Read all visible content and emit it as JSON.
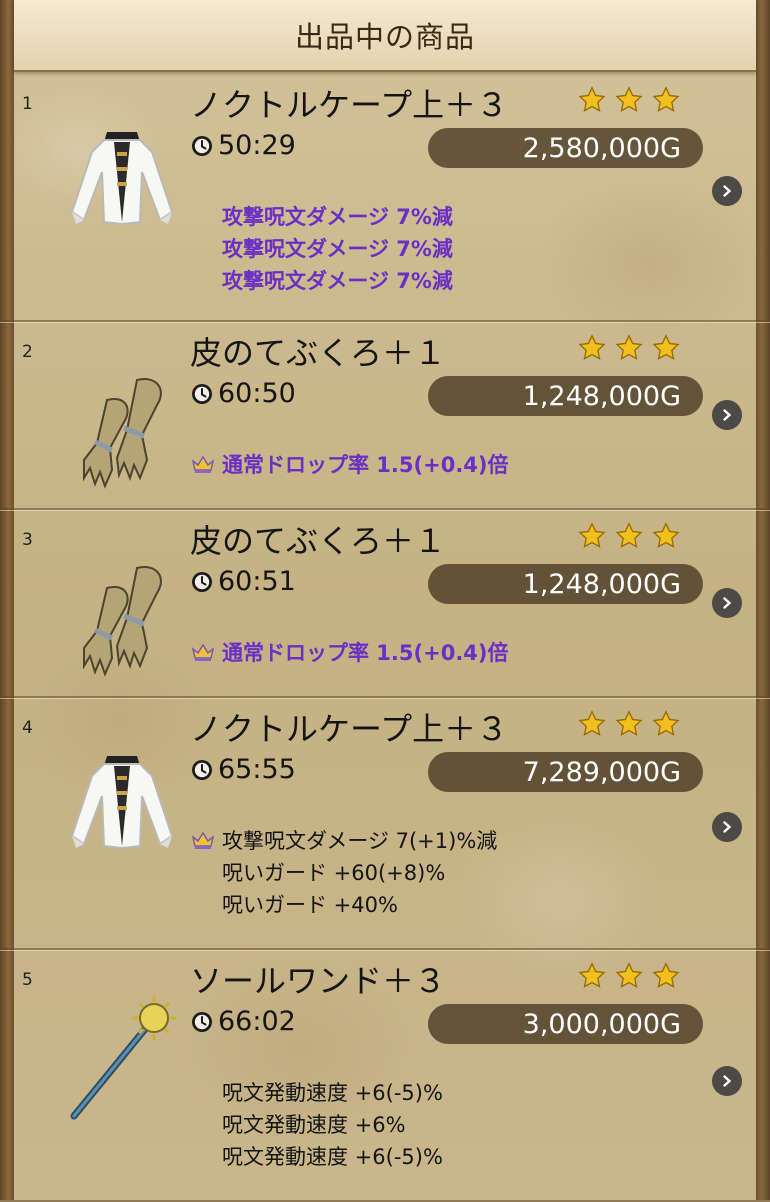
{
  "header": {
    "title": "出品中の商品"
  },
  "items": [
    {
      "index": "1",
      "name": "ノクトルケープ上＋３",
      "icon": "cape-icon",
      "timer": "50:29",
      "price": "2,580,000G",
      "stars": 3,
      "effects": [
        {
          "text": "攻撃呪文ダメージ 7%減",
          "style": "purple",
          "crown": false
        },
        {
          "text": "攻撃呪文ダメージ 7%減",
          "style": "purple",
          "crown": false
        },
        {
          "text": "攻撃呪文ダメージ 7%減",
          "style": "purple",
          "crown": false
        }
      ]
    },
    {
      "index": "2",
      "name": "皮のてぶくろ＋１",
      "icon": "gloves-icon",
      "timer": "60:50",
      "price": "1,248,000G",
      "stars": 3,
      "effects": [
        {
          "text": "通常ドロップ率 1.5(+0.4)倍",
          "style": "purple",
          "crown": true
        }
      ]
    },
    {
      "index": "3",
      "name": "皮のてぶくろ＋１",
      "icon": "gloves-icon",
      "timer": "60:51",
      "price": "1,248,000G",
      "stars": 3,
      "effects": [
        {
          "text": "通常ドロップ率 1.5(+0.4)倍",
          "style": "purple",
          "crown": true
        }
      ]
    },
    {
      "index": "4",
      "name": "ノクトルケープ上＋３",
      "icon": "cape-icon",
      "timer": "65:55",
      "price": "7,289,000G",
      "stars": 3,
      "effects": [
        {
          "text": "攻撃呪文ダメージ 7(+1)%減",
          "style": "dark",
          "crown": true
        },
        {
          "text": "呪いガード +60(+8)%",
          "style": "dark",
          "crown": false
        },
        {
          "text": "呪いガード +40%",
          "style": "dark",
          "crown": false
        }
      ]
    },
    {
      "index": "5",
      "name": "ソールワンド＋３",
      "icon": "wand-icon",
      "timer": "66:02",
      "price": "3,000,000G",
      "stars": 3,
      "effects": [
        {
          "text": "呪文発動速度 +6(-5)%",
          "style": "dark",
          "crown": false
        },
        {
          "text": "呪文発動速度 +6%",
          "style": "dark",
          "crown": false
        },
        {
          "text": "呪文発動速度 +6(-5)%",
          "style": "dark",
          "crown": false
        }
      ]
    }
  ],
  "colors": {
    "purple_effect": "#6a2fc4",
    "price_pill": "#463723",
    "star": "#f2c01e"
  }
}
